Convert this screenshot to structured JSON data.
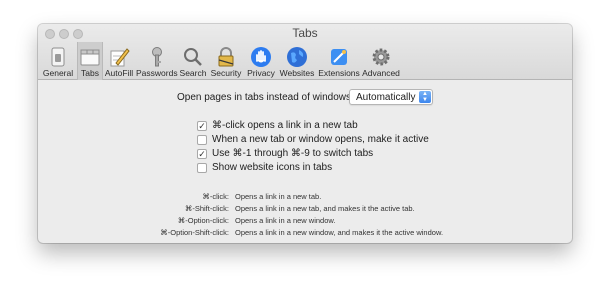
{
  "window": {
    "title": "Tabs"
  },
  "toolbar": {
    "tabs": [
      {
        "label": "General",
        "icon": "switch-icon"
      },
      {
        "label": "Tabs",
        "icon": "tabs-icon",
        "selected": true
      },
      {
        "label": "AutoFill",
        "icon": "pencil-form-icon"
      },
      {
        "label": "Passwords",
        "icon": "key-icon"
      },
      {
        "label": "Search",
        "icon": "magnifier-icon"
      },
      {
        "label": "Security",
        "icon": "lock-icon"
      },
      {
        "label": "Privacy",
        "icon": "hand-icon"
      },
      {
        "label": "Websites",
        "icon": "globe-icon"
      },
      {
        "label": "Extensions",
        "icon": "puzzle-icon"
      },
      {
        "label": "Advanced",
        "icon": "gear-icon"
      }
    ]
  },
  "open_pages": {
    "label": "Open pages in tabs instead of windows:",
    "value": "Automatically"
  },
  "options": [
    {
      "label": "⌘-click opens a link in a new tab",
      "checked": true
    },
    {
      "label": "When a new tab or window opens, make it active",
      "checked": false
    },
    {
      "label": "Use ⌘-1 through ⌘-9 to switch tabs",
      "checked": true
    },
    {
      "label": "Show website icons in tabs",
      "checked": false
    }
  ],
  "shortcuts": [
    {
      "key": "⌘-click:",
      "desc": "Opens a link in a new tab."
    },
    {
      "key": "⌘-Shift-click:",
      "desc": "Opens a link in a new tab, and makes it the active tab."
    },
    {
      "key": "⌘-Option-click:",
      "desc": "Opens a link in a new window."
    },
    {
      "key": "⌘-Option-Shift-click:",
      "desc": "Opens a link in a new window, and makes it the active window."
    }
  ],
  "help": {
    "label": "?"
  },
  "colors": {
    "accent": "#3d86ee",
    "window_bg": "#ececec",
    "toolbar_selected": "#cdcdcd"
  }
}
